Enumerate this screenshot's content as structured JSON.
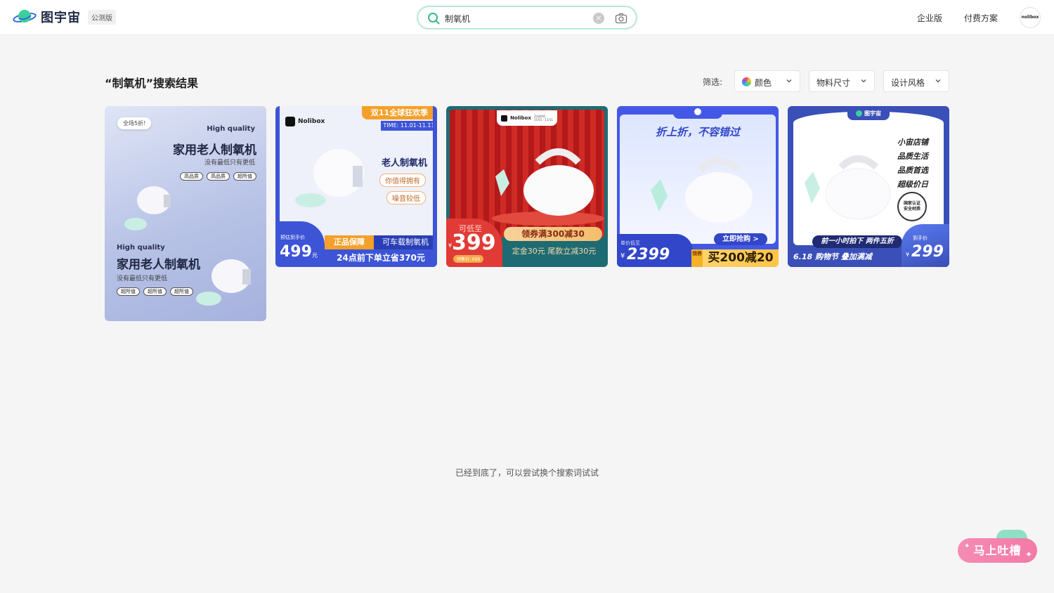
{
  "header": {
    "logo_text": "图宇宙",
    "badge": "公测版",
    "search": {
      "value": "制氧机",
      "placeholder": ""
    },
    "nav": {
      "enterprise": "企业版",
      "pricing": "付费方案"
    },
    "avatar_text": "nolibox"
  },
  "results": {
    "title": "“制氧机”搜索结果",
    "filter_label": "筛选:",
    "filters": [
      {
        "label": "颜色"
      },
      {
        "label": "物料尺寸"
      },
      {
        "label": "设计风格"
      }
    ]
  },
  "cards": [
    {
      "badge": "全场5折!",
      "top_hq": "High quality",
      "top_title": "家用老人制氧机",
      "top_sub": "没有最低只有更低",
      "top_tags": [
        "高品质",
        "高品质",
        "超所值"
      ],
      "bot_hq": "High quality",
      "bot_title": "家用老人制氧机",
      "bot_sub": "没有最低只有更低",
      "bot_tags": [
        "超所值",
        "超所值",
        "超所值"
      ]
    },
    {
      "ribbon": "双11全球狂欢季",
      "time": "TIME: 11.01-11.11",
      "brand": "Nolibox",
      "title": "老人制氧机",
      "pill1": "你值得拥有",
      "pill2": "噪音较低",
      "price_label": "预估到手价",
      "price": "499",
      "unit": "元",
      "guarantee": "正品保障",
      "car": "可车载制氧机",
      "deal": "24点前下单立省370元"
    },
    {
      "brand": "Nolibox",
      "event_label": "活动时间",
      "event_date": "11/01 - 11/11",
      "low_label": "可低至",
      "price": "399",
      "yen": "¥",
      "presale": "预售价: 699",
      "coupon": "领券满300减30",
      "deposit": "定金30元 尾款立减30元"
    },
    {
      "title": "折上折，不容错过",
      "buy": "立即抢购 >",
      "unit_label": "单价低至",
      "yen": "¥",
      "price": "2399",
      "coupon_tag": "领券",
      "promo": "买200减20"
    },
    {
      "brand": "图宇宙",
      "lines": [
        "小宙店铺",
        "品质生活",
        "品质首选",
        "超级价日"
      ],
      "cert": "国家认证 安全材质",
      "banner": "前一小时拍下 两件五折",
      "festival": "6.18 购物节  叠加满减",
      "hand_label": "到手价",
      "yen": "¥",
      "price": "299"
    }
  ],
  "bottom_note": "已经到底了，可以尝试换个搜索词试试",
  "feedback_label": "马上吐槽",
  "colors": {
    "accent": "#3bb58d",
    "blue": "#3d54d6",
    "red": "#c8201c",
    "orange": "#f5a623"
  }
}
